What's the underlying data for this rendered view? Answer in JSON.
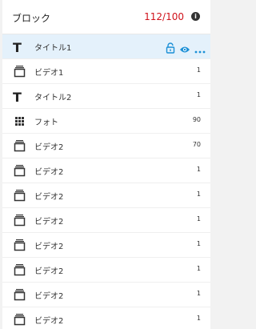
{
  "header": {
    "title": "ブロック",
    "count": "112/100",
    "count_color": "#d0121b",
    "info_glyph": "i"
  },
  "accent_color": "#1a8fd6",
  "rows": [
    {
      "type": "text-icon",
      "label": "タイトル1",
      "value": "",
      "selected": true
    },
    {
      "type": "video-icon",
      "label": "ビデオ1",
      "value": "1"
    },
    {
      "type": "text-icon",
      "label": "タイトル2",
      "value": "1"
    },
    {
      "type": "grid-icon",
      "label": "フォト",
      "value": "90"
    },
    {
      "type": "video-icon",
      "label": "ビデオ2",
      "value": "70"
    },
    {
      "type": "video-icon",
      "label": "ビデオ2",
      "value": "1"
    },
    {
      "type": "video-icon",
      "label": "ビデオ2",
      "value": "1"
    },
    {
      "type": "video-icon",
      "label": "ビデオ2",
      "value": "1"
    },
    {
      "type": "video-icon",
      "label": "ビデオ2",
      "value": "1"
    },
    {
      "type": "video-icon",
      "label": "ビデオ2",
      "value": "1"
    },
    {
      "type": "video-icon",
      "label": "ビデオ2",
      "value": "1"
    },
    {
      "type": "video-icon",
      "label": "ビデオ2",
      "value": "1"
    }
  ],
  "text_glyph": "T"
}
